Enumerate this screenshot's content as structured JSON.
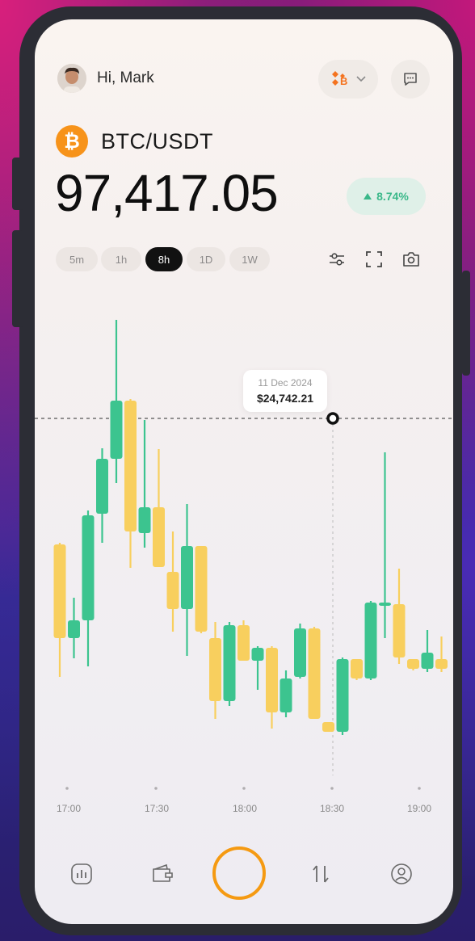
{
  "header": {
    "greeting": "Hi, Mark",
    "avatar_icon": "user-avatar",
    "exchange_icon": "binance-logo",
    "message_icon": "chat-icon"
  },
  "pair": {
    "symbol": "BTC/USDT",
    "icon": "bitcoin-icon",
    "price": "97,417.05",
    "change": "8.74%"
  },
  "timeframes": [
    "5m",
    "1h",
    "8h",
    "1D",
    "1W"
  ],
  "active_timeframe": "8h",
  "tools": [
    "sliders-icon",
    "fullscreen-icon",
    "camera-icon"
  ],
  "tooltip": {
    "date": "11 Dec 2024",
    "value": "$24,742.21"
  },
  "colors": {
    "up": "#3cc48f",
    "down": "#f8cf5e",
    "accent": "#f59a12",
    "positive_bg": "#dff0e8"
  },
  "chart_data": {
    "type": "candlestick",
    "x_ticks": [
      "17:00",
      "17:30",
      "18:00",
      "18:30",
      "19:00"
    ],
    "crosshair_value": 24742.21,
    "candles": [
      {
        "dir": "down",
        "wick": [
          672,
          838
        ],
        "body": [
          674,
          790
        ]
      },
      {
        "dir": "up",
        "wick": [
          740,
          815
        ],
        "body": [
          768,
          790
        ]
      },
      {
        "dir": "up",
        "wick": [
          632,
          825
        ],
        "body": [
          638,
          768
        ]
      },
      {
        "dir": "up",
        "wick": [
          555,
          672
        ],
        "body": [
          568,
          636
        ]
      },
      {
        "dir": "up",
        "wick": [
          396,
          598
        ],
        "body": [
          496,
          568
        ]
      },
      {
        "dir": "down",
        "wick": [
          494,
          703
        ],
        "body": [
          496,
          658
        ]
      },
      {
        "dir": "up",
        "wick": [
          520,
          678
        ],
        "body": [
          628,
          660
        ]
      },
      {
        "dir": "down",
        "wick": [
          556,
          700
        ],
        "body": [
          628,
          702
        ]
      },
      {
        "dir": "down",
        "wick": [
          658,
          782
        ],
        "body": [
          708,
          754
        ]
      },
      {
        "dir": "up",
        "wick": [
          624,
          812
        ],
        "body": [
          676,
          754
        ]
      },
      {
        "dir": "down",
        "wick": [
          676,
          784
        ],
        "body": [
          676,
          782
        ]
      },
      {
        "dir": "down",
        "wick": [
          770,
          890
        ],
        "body": [
          790,
          868
        ]
      },
      {
        "dir": "up",
        "wick": [
          770,
          874
        ],
        "body": [
          774,
          868
        ]
      },
      {
        "dir": "down",
        "wick": [
          768,
          818
        ],
        "body": [
          774,
          818
        ]
      },
      {
        "dir": "up",
        "wick": [
          800,
          854
        ],
        "body": [
          802,
          818
        ]
      },
      {
        "dir": "down",
        "wick": [
          800,
          902
        ],
        "body": [
          802,
          882
        ]
      },
      {
        "dir": "up",
        "wick": [
          830,
          888
        ],
        "body": [
          840,
          882
        ]
      },
      {
        "dir": "up",
        "wick": [
          772,
          840
        ],
        "body": [
          778,
          838
        ]
      },
      {
        "dir": "down",
        "wick": [
          776,
          890
        ],
        "body": [
          778,
          890
        ]
      },
      {
        "dir": "down",
        "wick": [
          894,
          906
        ],
        "body": [
          894,
          906
        ]
      },
      {
        "dir": "up",
        "wick": [
          814,
          910
        ],
        "body": [
          816,
          906
        ]
      },
      {
        "dir": "down",
        "wick": [
          816,
          842
        ],
        "body": [
          816,
          840
        ]
      },
      {
        "dir": "up",
        "wick": [
          744,
          842
        ],
        "body": [
          746,
          840
        ]
      },
      {
        "dir": "up",
        "wick": [
          560,
          790
        ],
        "body": [
          746,
          750
        ]
      },
      {
        "dir": "down",
        "wick": [
          704,
          822
        ],
        "body": [
          748,
          814
        ]
      },
      {
        "dir": "down",
        "wick": [
          816,
          830
        ],
        "body": [
          816,
          828
        ]
      },
      {
        "dir": "up",
        "wick": [
          780,
          832
        ],
        "body": [
          808,
          828
        ]
      },
      {
        "dir": "down",
        "wick": [
          788,
          832
        ],
        "body": [
          816,
          828
        ]
      }
    ]
  },
  "tabbar": [
    "chart-icon",
    "wallet-icon",
    "swap-icon",
    "profile-icon"
  ]
}
